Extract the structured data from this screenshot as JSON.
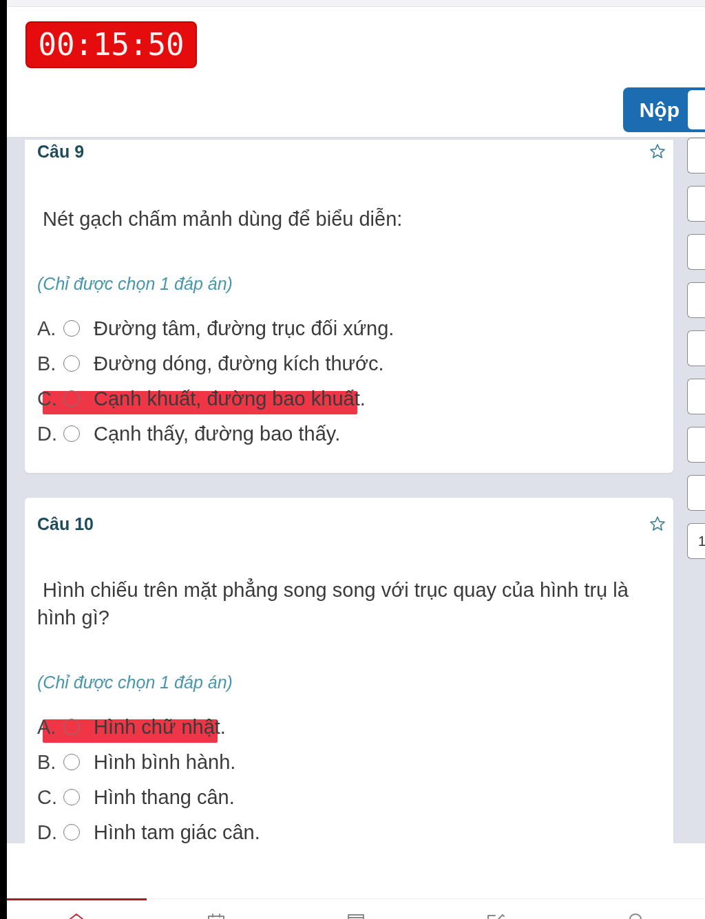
{
  "header": {
    "timer": "00:15:50",
    "submit_button": "Nộp"
  },
  "questions": [
    {
      "title": "Câu 9",
      "starred": false,
      "text": "Nét gạch chấm mảnh dùng để biểu diễn:",
      "hint": "(Chỉ được chọn 1 đáp án)",
      "options": [
        {
          "letter": "A.",
          "text": "Đường tâm, đường trục đối xứng.",
          "selected": false,
          "highlighted": false
        },
        {
          "letter": "B.",
          "text": "Đường dóng, đường kích thước.",
          "selected": false,
          "highlighted": false
        },
        {
          "letter": "C.",
          "text": "Cạnh khuất, đường bao khuất.",
          "selected": false,
          "highlighted": true
        },
        {
          "letter": "D.",
          "text": "Cạnh thấy, đường bao thấy.",
          "selected": false,
          "highlighted": false
        }
      ]
    },
    {
      "title": "Câu 10",
      "starred": false,
      "text": "Hình chiếu trên mặt phẳng song song với trục quay của hình trụ là hình gì?",
      "hint": "(Chỉ được chọn 1 đáp án)",
      "options": [
        {
          "letter": "A.",
          "text": "Hình chữ nhật.",
          "selected": false,
          "highlighted": true
        },
        {
          "letter": "B.",
          "text": "Hình bình hành.",
          "selected": false,
          "highlighted": false
        },
        {
          "letter": "C.",
          "text": "Hình thang cân.",
          "selected": false,
          "highlighted": false
        },
        {
          "letter": "D.",
          "text": "Hình tam giác cân.",
          "selected": false,
          "highlighted": false
        }
      ]
    }
  ],
  "question_nav": [
    {
      "kind": "blank"
    },
    {
      "kind": "blank"
    },
    {
      "kind": "blank"
    },
    {
      "kind": "blank"
    },
    {
      "kind": "blank"
    },
    {
      "kind": "blank"
    },
    {
      "kind": "blank"
    },
    {
      "kind": "blank"
    },
    {
      "kind": "numbered",
      "label": "1"
    }
  ],
  "bottom_tabs": [
    {
      "selected": true
    },
    {
      "selected": false
    },
    {
      "selected": false
    },
    {
      "selected": false
    },
    {
      "selected": false
    }
  ]
}
